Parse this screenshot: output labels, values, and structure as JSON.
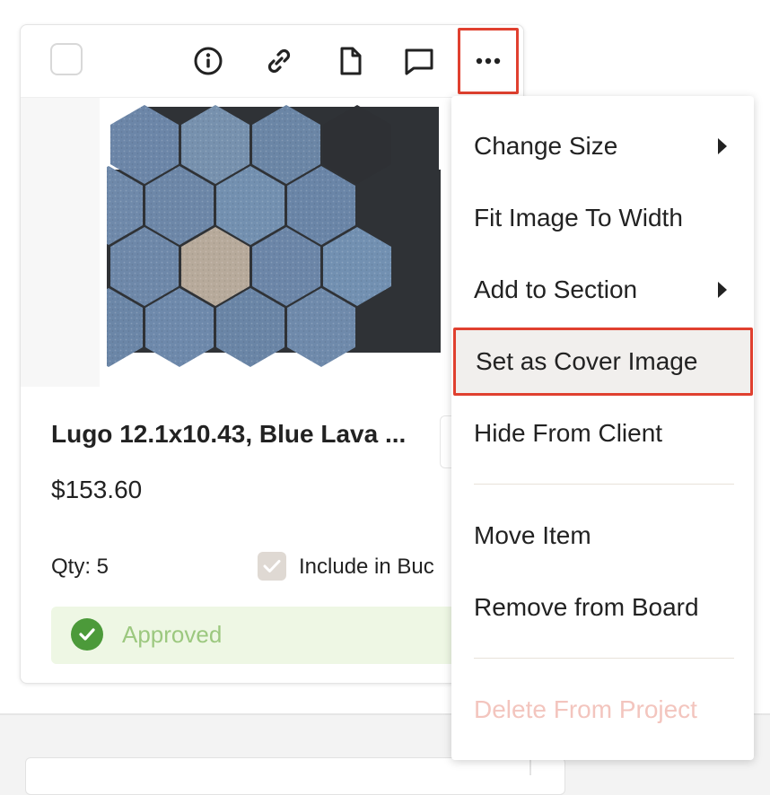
{
  "toolbar": {
    "icons": [
      "info-icon",
      "link-icon",
      "document-icon",
      "comment-icon",
      "more-icon"
    ]
  },
  "product": {
    "title": "Lugo 12.1x10.43, Blue Lava ...",
    "price": "$153.60",
    "qty_label": "Qty: 5",
    "include_label": "Include in Buc",
    "include_checked": true,
    "status": "Approved",
    "status_color": "#4c9a3a"
  },
  "menu": {
    "items": [
      {
        "label": "Change Size",
        "submenu": true
      },
      {
        "label": "Fit Image To Width",
        "submenu": false
      },
      {
        "label": "Add to Section",
        "submenu": true
      },
      {
        "label": "Set as Cover Image",
        "submenu": false,
        "highlighted": true
      },
      {
        "label": "Hide From Client",
        "submenu": false
      },
      {
        "label": "Move Item",
        "submenu": false
      },
      {
        "label": "Remove from Board",
        "submenu": false
      },
      {
        "label": "Delete From Project",
        "submenu": false,
        "disabled": true
      }
    ]
  },
  "colors": {
    "highlight_outline": "#e0402f",
    "disabled_text": "#f3c5be",
    "approved_bg": "#eef7e4",
    "tile_blue": "#6c86a8",
    "tile_black": "#2e3034",
    "tile_beige": "#b7aa9b"
  }
}
